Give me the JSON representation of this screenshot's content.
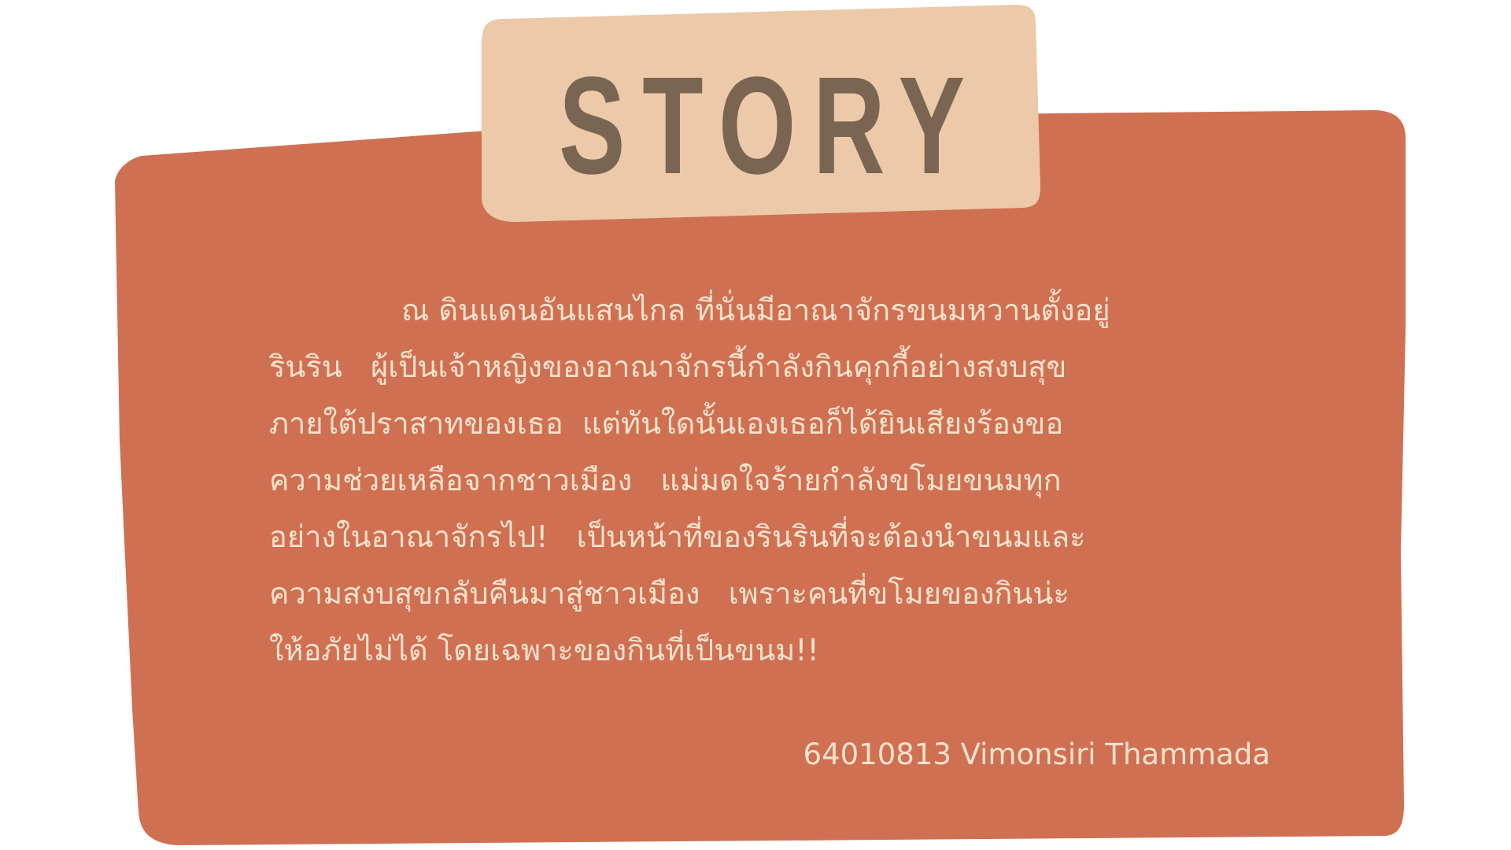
{
  "title": "STORY",
  "story_lines": [
    "ณ ดินแดนอันแสนไกล ที่นั่นมีอาณาจักรขนมหวานตั้งอยู่",
    "รินริน   ผู้เป็นเจ้าหญิงของอาณาจักรนี้กำลังกินคุกกี้อย่างสงบสุข",
    "ภายใต้ปราสาทของเธอ  แต่ทันใดนั้นเองเธอก็ได้ยินเสียงร้องขอ",
    "ความช่วยเหลือจากชาวเมือง   แม่มดใจร้ายกำลังขโมยขนมทุก",
    "อย่างในอาณาจักรไป!   เป็นหน้าที่ของรินรินที่จะต้องนำขนมและ",
    "ความสงบสุขกลับคืนมาสู่ชาวเมือง   เพราะคนที่ขโมยของกินน่ะ",
    "ให้อภัยไม่ได้ โดยเฉพาะของกินที่เป็นขนม!!"
  ],
  "credit": "64010813 Vimonsiri Thammada",
  "colors": {
    "card": "#d07052",
    "title_tab": "#ecc9a8",
    "title_text": "#7a6553",
    "body_text": "#f4e2cc",
    "background": "#ffffff"
  }
}
